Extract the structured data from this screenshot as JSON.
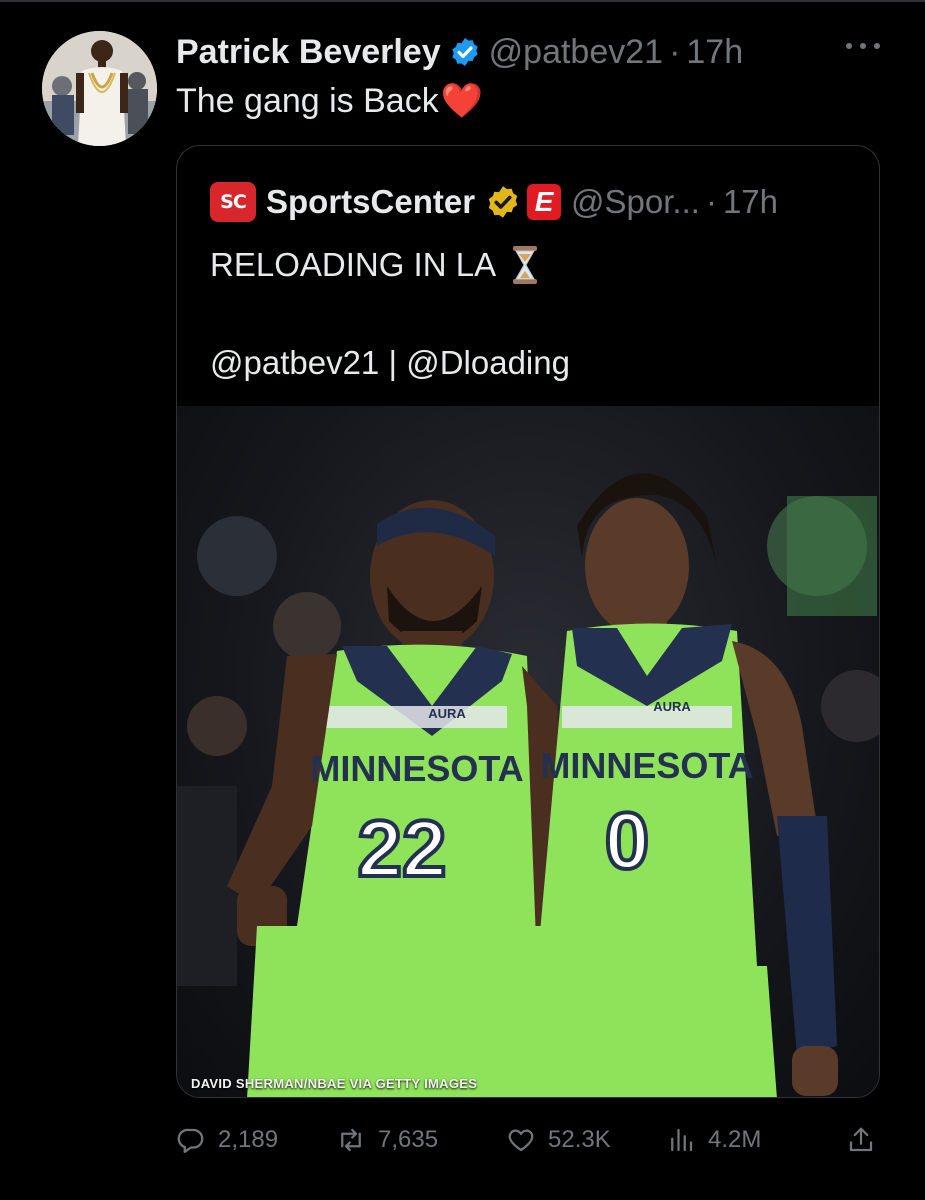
{
  "tweet": {
    "author_name": "Patrick Beverley",
    "handle": "@patbev21",
    "separator": "·",
    "time": "17h",
    "text": "The gang is Back",
    "text_emoji": "❤️"
  },
  "quoted_tweet": {
    "logo_text": "SC",
    "author_name": "SportsCenter",
    "handle": "@Spor...",
    "separator": "·",
    "time": "17h",
    "line1": "RELOADING IN LA",
    "line2": "@patbev21 | @Dloading",
    "photo_credit": "DAVID SHERMAN/NBAE VIA GETTY IMAGES",
    "jersey_text": "MINNESOTA",
    "jersey_brand": "AURA",
    "player_numbers": [
      "22",
      "0"
    ]
  },
  "actions": {
    "replies": "2,189",
    "retweets": "7,635",
    "likes": "52.3K",
    "views": "4.2M"
  },
  "colors": {
    "background": "#000000",
    "text_primary": "#e7e9ea",
    "text_secondary": "#71767b",
    "border": "#2f3336",
    "verified_blue": "#1d9bf0",
    "verified_gold": "#e2b719",
    "jersey_green": "#8fe35a",
    "jersey_navy": "#24304f"
  }
}
